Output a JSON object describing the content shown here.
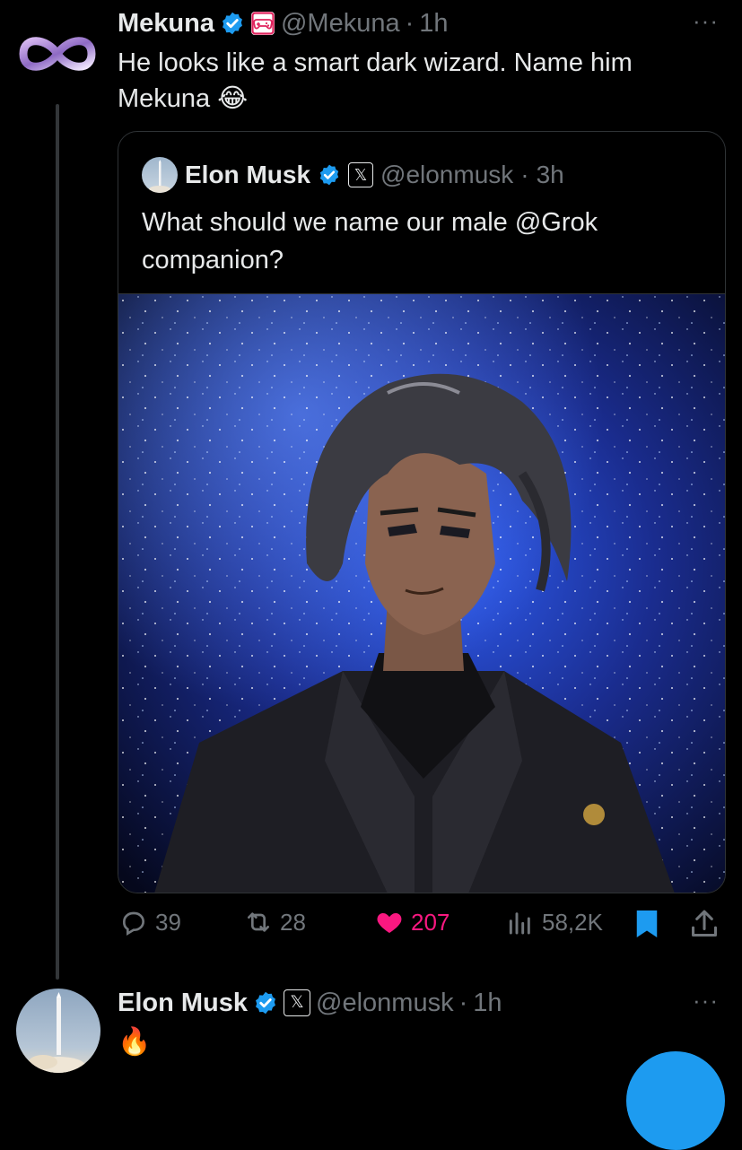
{
  "reply": {
    "display_name": "Mekuna",
    "handle": "@Mekuna",
    "separator": "·",
    "time": "1h",
    "text": "He looks like a smart dark wizard. Name him Mekuna 😂",
    "avatar_icon": "infinity-icon",
    "badge_icon": "gamepad-icon",
    "more": "···"
  },
  "quoted": {
    "display_name": "Elon Musk",
    "handle": "@elonmusk",
    "separator": "·",
    "time": "3h",
    "text": "What should we name our male @Grok companion?",
    "affiliate_badge": "𝕏"
  },
  "actions": {
    "replies": "39",
    "reposts": "28",
    "likes": "207",
    "views": "58,2K"
  },
  "next_tweet": {
    "display_name": "Elon Musk",
    "handle": "@elonmusk",
    "separator": "·",
    "time": "1h",
    "text": "🔥",
    "affiliate_badge": "𝕏",
    "more": "···"
  },
  "colors": {
    "background": "#000000",
    "text": "#e7e9ea",
    "muted": "#71767b",
    "verified": "#1d9bf0",
    "like": "#f91880",
    "bookmark": "#1d9bf0"
  }
}
